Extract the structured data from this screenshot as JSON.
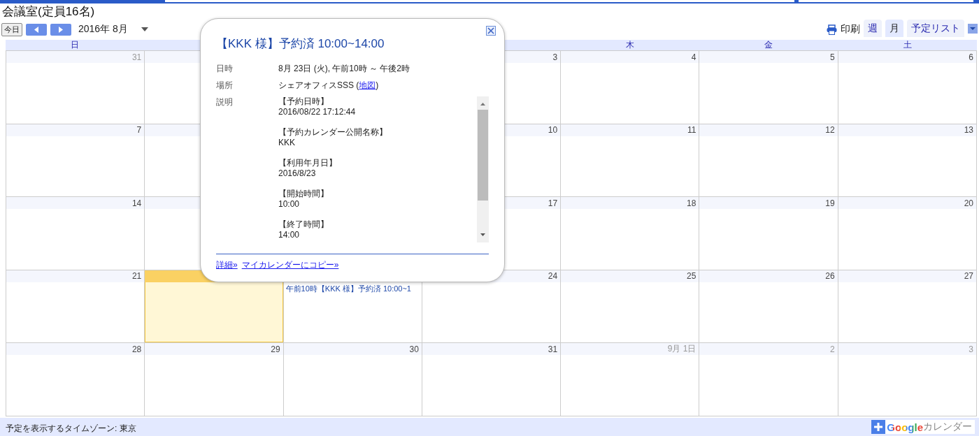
{
  "calendar_title": "会議室(定員16名)",
  "toolbar": {
    "today": "今日",
    "period": "2016年 8月",
    "print": "印刷",
    "views": [
      {
        "label": "週",
        "selected": false
      },
      {
        "label": "月",
        "selected": true
      },
      {
        "label": "予定リスト",
        "selected": false
      }
    ]
  },
  "weekdays": {
    "sun": "日",
    "thu": "木",
    "fri": "金",
    "sat": "土"
  },
  "weeks": [
    {
      "sun": {
        "label": "31",
        "other_month": true,
        "today": false
      },
      "mon": {
        "today": false
      },
      "wed": {
        "label": "3",
        "other_month": false,
        "today": false
      },
      "thu": {
        "label": "4",
        "other_month": false,
        "today": false
      },
      "fri": {
        "label": "5",
        "other_month": false,
        "today": false
      },
      "sat": {
        "label": "6",
        "other_month": false,
        "today": false
      }
    },
    {
      "sun": {
        "label": "7",
        "other_month": false,
        "today": false
      },
      "mon": {
        "today": false
      },
      "wed": {
        "label": "10",
        "other_month": false,
        "today": false
      },
      "thu": {
        "label": "11",
        "other_month": false,
        "today": false
      },
      "fri": {
        "label": "12",
        "other_month": false,
        "today": false
      },
      "sat": {
        "label": "13",
        "other_month": false,
        "today": false
      }
    },
    {
      "sun": {
        "label": "14",
        "other_month": false,
        "today": false
      },
      "mon": {
        "today": false
      },
      "wed": {
        "label": "17",
        "other_month": false,
        "today": false
      },
      "thu": {
        "label": "18",
        "other_month": false,
        "today": false
      },
      "fri": {
        "label": "19",
        "other_month": false,
        "today": false
      },
      "sat": {
        "label": "20",
        "other_month": false,
        "today": false
      }
    },
    {
      "sun": {
        "label": "21",
        "other_month": false,
        "today": false
      },
      "mon": {
        "today": true
      },
      "tue": {
        "today": false,
        "events": [
          "午前10時【KKK 様】予約済 10:00~1"
        ]
      },
      "wed": {
        "label": "24",
        "other_month": false,
        "today": false
      },
      "thu": {
        "label": "25",
        "other_month": false,
        "today": false
      },
      "fri": {
        "label": "26",
        "other_month": false,
        "today": false
      },
      "sat": {
        "label": "27",
        "other_month": false,
        "today": false
      }
    },
    {
      "sun": {
        "label": "28",
        "other_month": false,
        "today": false
      },
      "mon": {
        "label": "29",
        "other_month": false,
        "today": false
      },
      "tue": {
        "label": "30",
        "other_month": false,
        "today": false
      },
      "wed": {
        "label": "31",
        "other_month": false,
        "today": false
      },
      "thu": {
        "label": "9月 1日",
        "other_month": true,
        "today": false
      },
      "fri": {
        "label": "2",
        "other_month": true,
        "today": false
      },
      "sat": {
        "label": "3",
        "other_month": true,
        "today": false
      }
    }
  ],
  "popup": {
    "title": "【KKK 様】予約済 10:00~14:00",
    "when": {
      "label": "日時",
      "value": "8月 23日 (火), 午前10時 ～ 午後2時"
    },
    "where": {
      "label": "場所",
      "before": "シェアオフィスSSS (",
      "link": "地図",
      "after": ")"
    },
    "description": {
      "label": "説明",
      "blocks": [
        {
          "heading": "【予約日時】",
          "value": "2016/08/22 17:12:44"
        },
        {
          "heading": "【予約カレンダー公開名称】",
          "value": "KKK"
        },
        {
          "heading": "【利用年月日】",
          "value": "2016/8/23"
        },
        {
          "heading": "【開始時間】",
          "value": "10:00"
        },
        {
          "heading": "【終了時間】",
          "value": "14:00"
        }
      ]
    },
    "links": [
      "詳細»",
      "マイカレンダーにコピー»"
    ]
  },
  "footer": {
    "timezone": "予定を表示するタイムゾーン: 東京",
    "badge_brand": "Google",
    "badge_label": "カレンダー"
  }
}
